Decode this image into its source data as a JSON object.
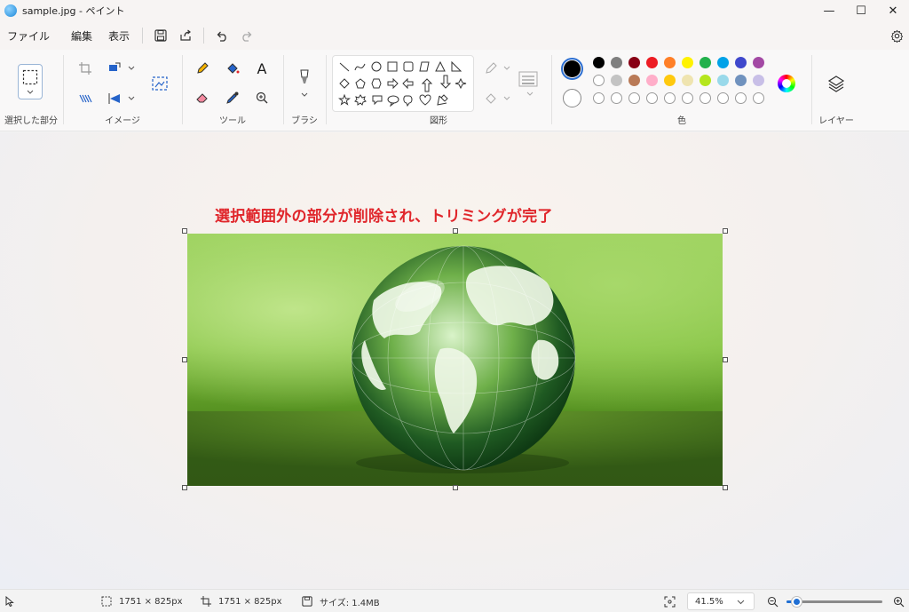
{
  "window": {
    "title": "sample.jpg - ペイント",
    "minimize_glyph": "—",
    "maximize_glyph": "☐",
    "close_glyph": "✕"
  },
  "menu": {
    "file": "ファイル",
    "edit": "編集",
    "view": "表示"
  },
  "ribbon": {
    "selection_label": "選択した部分",
    "image_label": "イメージ",
    "tools_label": "ツール",
    "text_tool_glyph": "A",
    "brush_label": "ブラシ",
    "shapes_label": "図形",
    "colors_label": "色",
    "layers_label": "レイヤー"
  },
  "colors": {
    "primary": "#000000",
    "secondary": "#ffffff",
    "palette_row1": [
      "#000000",
      "#7f7f7f",
      "#880015",
      "#ed1c24",
      "#ff7f27",
      "#fff200",
      "#22b14c",
      "#00a2e8",
      "#3f48cc",
      "#a349a4"
    ],
    "palette_row2": [
      "#ffffff",
      "#c3c3c3",
      "#b97a57",
      "#ffaec9",
      "#ffc90e",
      "#efe4b0",
      "#b5e61d",
      "#99d9ea",
      "#7092be",
      "#c8bfe7"
    ],
    "custom_slots": 10
  },
  "canvas": {
    "annotation": "選択範囲外の部分が削除され、トリミングが完了"
  },
  "status": {
    "selection_size": "1751 × 825px",
    "canvas_size": "1751 × 825px",
    "file_size": "サイズ: 1.4MB",
    "zoom": "41.5%",
    "zoom_level": 0.1
  }
}
